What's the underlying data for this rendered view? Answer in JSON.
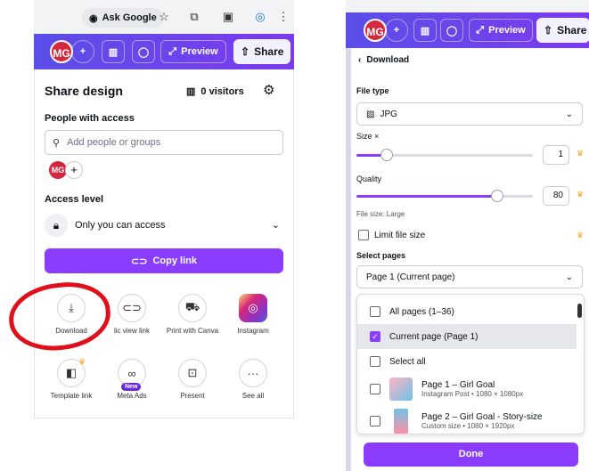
{
  "left": {
    "chrome": {
      "ask_google": "Ask Google"
    },
    "bar": {
      "avatar": "MG",
      "preview": "Preview",
      "share": "Share"
    },
    "share_design": {
      "title": "Share design",
      "visitors": "0 visitors",
      "people_label": "People with access",
      "people_placeholder": "Add people or groups",
      "avatar": "MG",
      "access_label": "Access level",
      "access_value": "Only you can access",
      "copy_link": "Copy link",
      "options": [
        {
          "label": "Download",
          "icon": "download-icon"
        },
        {
          "label": "Public view link",
          "icon": "link-icon"
        },
        {
          "label": "Print with Canva",
          "icon": "truck-icon"
        },
        {
          "label": "Instagram",
          "icon": "instagram-icon"
        },
        {
          "label": "Template link",
          "icon": "template-icon"
        },
        {
          "label": "Meta Ads",
          "icon": "meta-icon"
        },
        {
          "label": "Present",
          "icon": "present-icon"
        },
        {
          "label": "See all",
          "icon": "more-icon"
        }
      ],
      "meta_badge": "New",
      "public_view_visible": "lic view link"
    }
  },
  "right": {
    "bar": {
      "avatar": "MG",
      "preview": "Preview",
      "share": "Share"
    },
    "download": {
      "header": "Download",
      "file_type_label": "File type",
      "file_type": "JPG",
      "size_label": "Size ×",
      "size_value": "1",
      "size_fraction": 0.17,
      "quality_label": "Quality",
      "quality_value": "80",
      "quality_fraction": 0.8,
      "file_size": "File size: Large",
      "limit_file_size": "Limit file size",
      "select_pages_label": "Select pages",
      "select_pages_value": "Page 1 (Current page)",
      "page_options": [
        {
          "label": "All pages (1–36)",
          "checked": false
        },
        {
          "label": "Current page (Page 1)",
          "checked": true
        },
        {
          "label": "Select all",
          "checked": false
        }
      ],
      "pages": [
        {
          "title": "Page 1 – Girl Goal",
          "sub": "Instagram Post • 1080 × 1080px"
        },
        {
          "title": "Page 2 – Girl Goal - Story-size",
          "sub": "Custom size • 1080 × 1920px"
        }
      ],
      "done": "Done"
    }
  },
  "colors": {
    "accent": "#8b3dff",
    "annotation": "#e0101a"
  }
}
